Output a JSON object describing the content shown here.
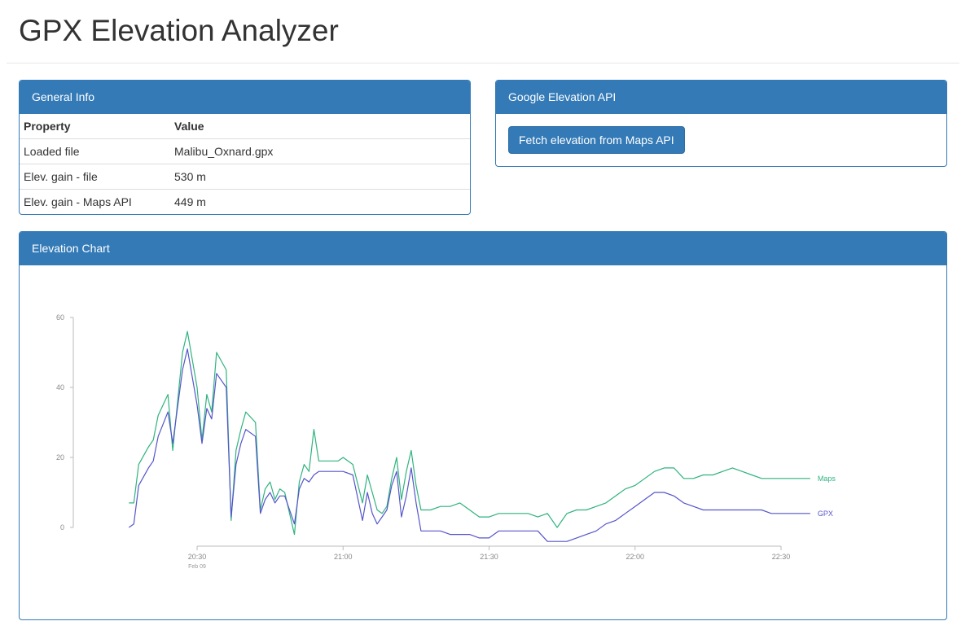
{
  "page": {
    "title": "GPX Elevation Analyzer"
  },
  "general_info": {
    "heading": "General Info",
    "columns": [
      "Property",
      "Value"
    ],
    "rows": [
      {
        "property": "Loaded file",
        "value": "Malibu_Oxnard.gpx"
      },
      {
        "property": "Elev. gain - file",
        "value": "530 m"
      },
      {
        "property": "Elev. gain - Maps API",
        "value": "449 m"
      }
    ]
  },
  "google_api": {
    "heading": "Google Elevation API",
    "button_label": "Fetch elevation from Maps API"
  },
  "elevation_chart": {
    "heading": "Elevation Chart"
  },
  "colors": {
    "panel_blue": "#337ab7",
    "gpx_line": "#5555cc",
    "maps_line": "#2fb37e"
  },
  "chart_data": {
    "type": "line",
    "title": "",
    "xlabel": "",
    "ylabel": "",
    "x_type": "time",
    "xlim": [
      "20:15",
      "22:36"
    ],
    "ylim": [
      0,
      60
    ],
    "y_ticks": [
      0,
      20,
      40,
      60
    ],
    "x_ticks": [
      {
        "label": "20:30",
        "sublabel": "Feb 09",
        "t": "20:30"
      },
      {
        "label": "21:00",
        "sublabel": "",
        "t": "21:00"
      },
      {
        "label": "21:30",
        "sublabel": "",
        "t": "21:30"
      },
      {
        "label": "22:00",
        "sublabel": "",
        "t": "22:00"
      },
      {
        "label": "22:30",
        "sublabel": "",
        "t": "22:30"
      }
    ],
    "grid": false,
    "legend": "end-of-line labels",
    "series": [
      {
        "name": "Maps",
        "color": "#2fb37e",
        "x": [
          "20:16",
          "20:17",
          "20:18",
          "20:20",
          "20:21",
          "20:22",
          "20:24",
          "20:25",
          "20:27",
          "20:28",
          "20:30",
          "20:31",
          "20:32",
          "20:33",
          "20:34",
          "20:36",
          "20:37",
          "20:38",
          "20:39",
          "20:40",
          "20:42",
          "20:43",
          "20:44",
          "20:45",
          "20:46",
          "20:47",
          "20:48",
          "20:50",
          "20:51",
          "20:52",
          "20:53",
          "20:54",
          "20:55",
          "20:56",
          "20:57",
          "20:58",
          "20:59",
          "21:00",
          "21:02",
          "21:04",
          "21:05",
          "21:06",
          "21:07",
          "21:08",
          "21:09",
          "21:10",
          "21:11",
          "21:12",
          "21:13",
          "21:14",
          "21:15",
          "21:16",
          "21:18",
          "21:20",
          "21:22",
          "21:24",
          "21:26",
          "21:28",
          "21:30",
          "21:32",
          "21:34",
          "21:36",
          "21:38",
          "21:40",
          "21:42",
          "21:44",
          "21:46",
          "21:48",
          "21:50",
          "21:52",
          "21:54",
          "21:56",
          "21:58",
          "22:00",
          "22:02",
          "22:04",
          "22:06",
          "22:08",
          "22:10",
          "22:12",
          "22:14",
          "22:16",
          "22:18",
          "22:20",
          "22:22",
          "22:24",
          "22:26",
          "22:28",
          "22:30",
          "22:32",
          "22:34",
          "22:36"
        ],
        "y": [
          7,
          7,
          18,
          23,
          25,
          32,
          38,
          22,
          50,
          56,
          40,
          25,
          38,
          33,
          50,
          45,
          2,
          22,
          28,
          33,
          30,
          5,
          11,
          13,
          8,
          11,
          10,
          -2,
          13,
          18,
          16,
          28,
          19,
          19,
          19,
          19,
          19,
          20,
          18,
          7,
          15,
          10,
          5,
          4,
          6,
          14,
          20,
          8,
          16,
          22,
          12,
          5,
          5,
          6,
          6,
          7,
          5,
          3,
          3,
          4,
          4,
          4,
          4,
          3,
          4,
          0,
          4,
          5,
          5,
          6,
          7,
          9,
          11,
          12,
          14,
          16,
          17,
          17,
          14,
          14,
          15,
          15,
          16,
          17,
          16,
          15,
          14,
          14,
          14,
          14,
          14,
          14
        ]
      },
      {
        "name": "GPX",
        "color": "#5555cc",
        "x": [
          "20:16",
          "20:17",
          "20:18",
          "20:20",
          "20:21",
          "20:22",
          "20:24",
          "20:25",
          "20:27",
          "20:28",
          "20:30",
          "20:31",
          "20:32",
          "20:33",
          "20:34",
          "20:36",
          "20:37",
          "20:38",
          "20:39",
          "20:40",
          "20:42",
          "20:43",
          "20:44",
          "20:45",
          "20:46",
          "20:47",
          "20:48",
          "20:50",
          "20:51",
          "20:52",
          "20:53",
          "20:54",
          "20:55",
          "20:56",
          "20:57",
          "20:58",
          "20:59",
          "21:00",
          "21:02",
          "21:04",
          "21:05",
          "21:06",
          "21:07",
          "21:08",
          "21:09",
          "21:10",
          "21:11",
          "21:12",
          "21:13",
          "21:14",
          "21:15",
          "21:16",
          "21:18",
          "21:20",
          "21:22",
          "21:24",
          "21:26",
          "21:28",
          "21:30",
          "21:32",
          "21:34",
          "21:36",
          "21:38",
          "21:40",
          "21:42",
          "21:44",
          "21:46",
          "21:48",
          "21:50",
          "21:52",
          "21:54",
          "21:56",
          "21:58",
          "22:00",
          "22:02",
          "22:04",
          "22:06",
          "22:08",
          "22:10",
          "22:12",
          "22:14",
          "22:16",
          "22:18",
          "22:20",
          "22:22",
          "22:24",
          "22:26",
          "22:28",
          "22:30",
          "22:32",
          "22:34",
          "22:36"
        ],
        "y": [
          0,
          1,
          12,
          17,
          19,
          26,
          33,
          24,
          45,
          51,
          35,
          24,
          34,
          31,
          44,
          40,
          3,
          18,
          24,
          28,
          26,
          4,
          8,
          10,
          7,
          9,
          9,
          1,
          11,
          14,
          13,
          15,
          16,
          16,
          16,
          16,
          16,
          16,
          15,
          2,
          10,
          4,
          1,
          3,
          5,
          12,
          16,
          3,
          9,
          17,
          7,
          -1,
          -1,
          -1,
          -2,
          -2,
          -2,
          -3,
          -3,
          -1,
          -1,
          -1,
          -1,
          -1,
          -4,
          -4,
          -4,
          -3,
          -2,
          -1,
          1,
          2,
          4,
          6,
          8,
          10,
          10,
          9,
          7,
          6,
          5,
          5,
          5,
          5,
          5,
          5,
          5,
          4,
          4,
          4,
          4,
          4
        ]
      }
    ]
  }
}
